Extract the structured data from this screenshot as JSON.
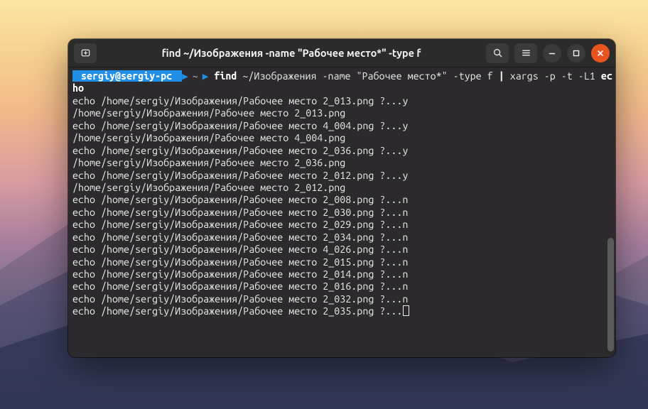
{
  "window": {
    "title": "find ~/Изображения -name \"Рабочее место*\" -type f"
  },
  "prompt": {
    "user_host": "sergiy@sergiy-pc",
    "path": "~",
    "command": "find ~/Изображения -name \"Рабочее место*\" -type f | xargs -p -t -L1 echo"
  },
  "base_path": "/home/sergiy/Изображения/Рабочее место ",
  "output_pairs": [
    {
      "file": "2_013.png",
      "answer": "y"
    },
    {
      "file": "4_004.png",
      "answer": "y"
    },
    {
      "file": "2_036.png",
      "answer": "y"
    },
    {
      "file": "2_012.png",
      "answer": "y"
    }
  ],
  "output_single_n": [
    "2_008.png",
    "2_030.png",
    "2_029.png",
    "2_034.png",
    "4_026.png",
    "2_015.png",
    "2_014.png",
    "2_016.png",
    "2_032.png"
  ],
  "pending_file": "2_035.png",
  "icons": {
    "new_tab": "new-tab-icon",
    "search": "search-icon",
    "menu": "hamburger-icon",
    "minimize": "minimize-icon",
    "maximize": "maximize-icon",
    "close": "close-icon"
  }
}
